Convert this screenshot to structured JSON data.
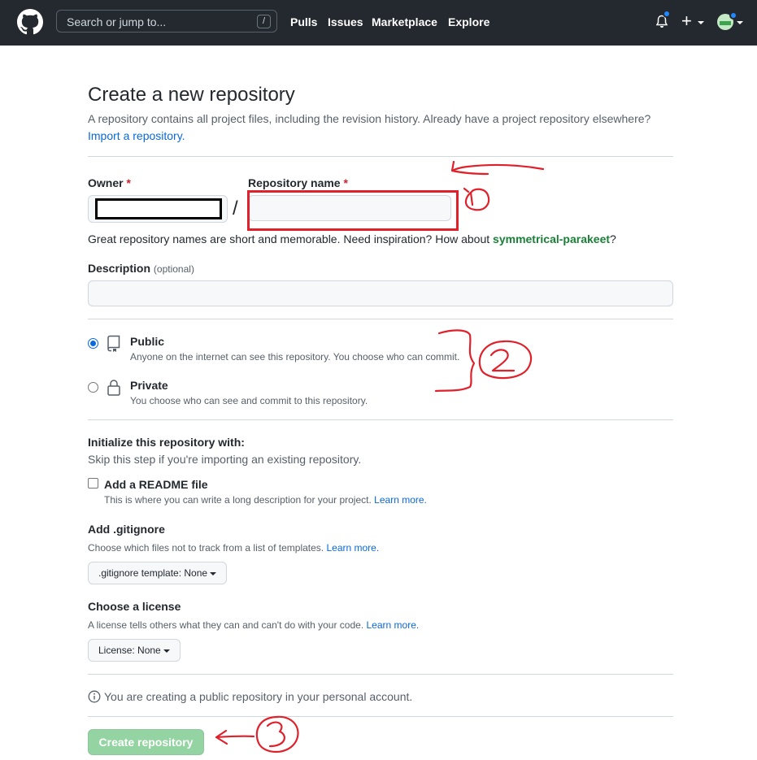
{
  "header": {
    "search_placeholder": "Search or jump to...",
    "search_key": "/",
    "nav": [
      "Pulls",
      "Issues",
      "Marketplace",
      "Explore"
    ],
    "plus_label": "+"
  },
  "page": {
    "title": "Create a new repository",
    "subtitle": "A repository contains all project files, including the revision history. Already have a project repository elsewhere?",
    "import_link": "Import a repository."
  },
  "owner": {
    "label": "Owner",
    "required": "*"
  },
  "repo_name": {
    "label": "Repository name",
    "required": "*",
    "separator": "/",
    "value": ""
  },
  "hint": {
    "text": "Great repository names are short and memorable. Need inspiration? How about",
    "suggestion": "symmetrical-parakeet",
    "end": "?"
  },
  "description": {
    "label": "Description",
    "optional": "(optional)",
    "value": ""
  },
  "visibility": {
    "public": {
      "label": "Public",
      "desc": "Anyone on the internet can see this repository. You choose who can commit.",
      "selected": true
    },
    "private": {
      "label": "Private",
      "desc": "You choose who can see and commit to this repository.",
      "selected": false
    }
  },
  "init": {
    "title": "Initialize this repository with:",
    "subtitle": "Skip this step if you're importing an existing repository.",
    "readme_label": "Add a README file",
    "readme_desc": "This is where you can write a long description for your project.",
    "learn_more": "Learn more.",
    "readme_checked": false
  },
  "gitignore": {
    "title": "Add .gitignore",
    "desc": "Choose which files not to track from a list of templates.",
    "learn_more": "Learn more.",
    "button": ".gitignore template: None"
  },
  "license": {
    "title": "Choose a license",
    "desc": "A license tells others what they can and can't do with your code.",
    "learn_more": "Learn more.",
    "button": "License: None"
  },
  "notice": {
    "text": "You are creating a public repository in your personal account."
  },
  "submit": {
    "label": "Create repository"
  },
  "colors": {
    "header_bg": "#24292f",
    "link": "#0969da",
    "annotation_red": "#e0202a",
    "create_button": "#94d3a2",
    "suggestion_green": "#1a7f37"
  }
}
